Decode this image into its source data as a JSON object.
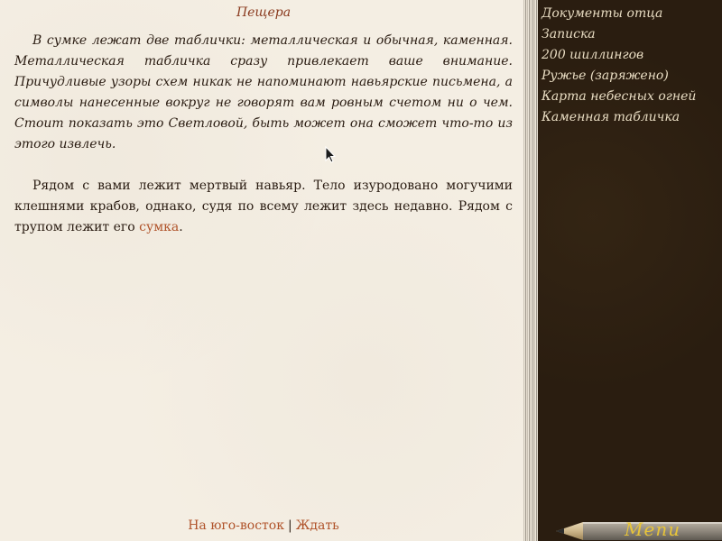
{
  "location": {
    "title": "Пещера"
  },
  "story": {
    "paragraph1": "В сумке лежат две таблички: металлическая и обычная, каменная. Металлическая табличка сразу привлекает ваше внимание. Причудливые узоры схем никак не напоминают навьярские письмена, а символы нанесенные вокруг не говорят вам ровным счетом ни о чем. Стоит показать это Светловой, быть может она сможет что-то из этого извлечь.",
    "paragraph2_text": "Рядом с вами лежит мертвый навьяр. Тело изуродовано могучими клешнями крабов, однако, судя по всему лежит здесь недавно. Рядом с трупом лежит его ",
    "paragraph2_link": "сумка",
    "paragraph2_end": "."
  },
  "actions": {
    "go_southeast": "На юго-восток",
    "separator": "|",
    "wait": "Ждать"
  },
  "inventory": {
    "items": [
      {
        "label": "Документы отца"
      },
      {
        "label": "Записка"
      },
      {
        "label": "200 шиллингов"
      },
      {
        "label": "Ружье (заряжено)"
      },
      {
        "label": "Карта небесных огней"
      },
      {
        "label": "Каменная табличка"
      }
    ]
  },
  "menu": {
    "label": "Menu"
  },
  "colors": {
    "link": "#b0532a",
    "title": "#8a3a1e",
    "sidebar_bg": "#2a1d10",
    "menu_text": "#e7c43a"
  },
  "icons": {
    "cursor": "arrow-cursor-icon",
    "menu_pencil": "pencil-icon"
  }
}
